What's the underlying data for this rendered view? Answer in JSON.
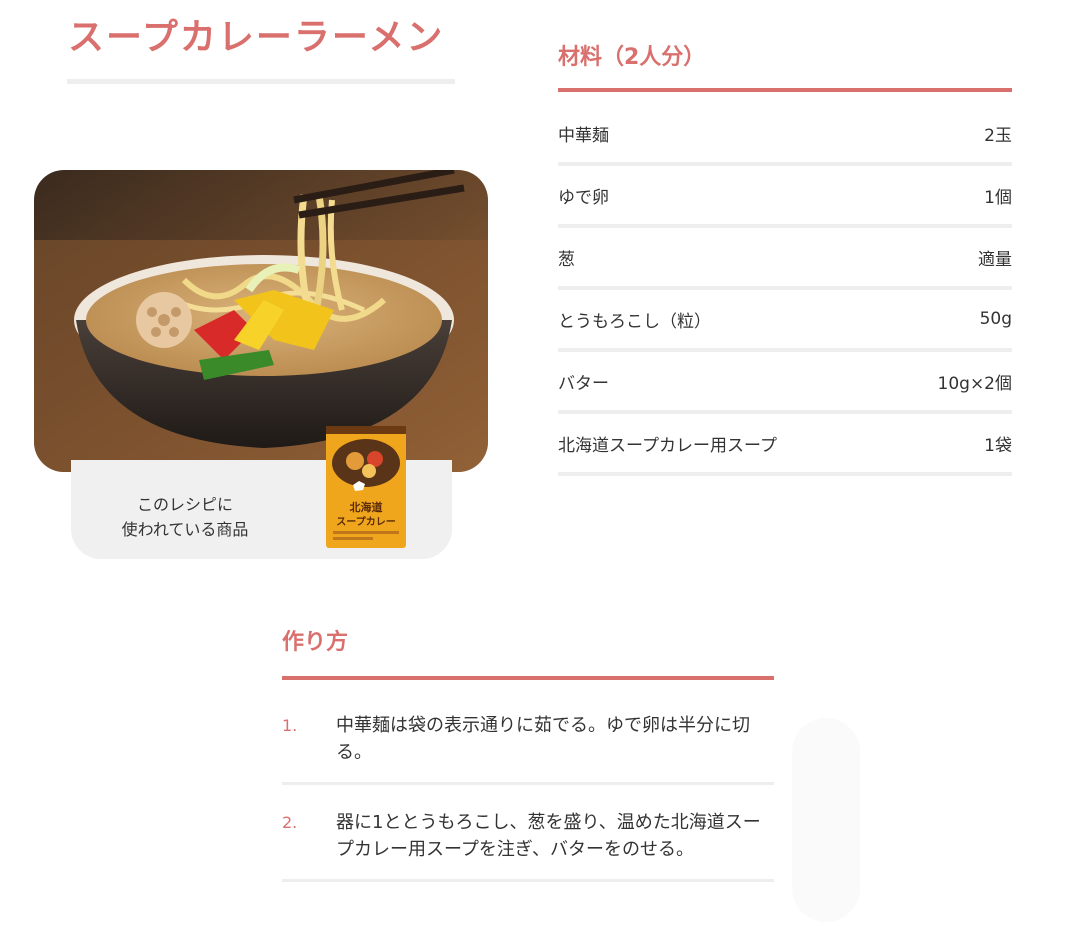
{
  "recipe": {
    "title": "スープカレーラーメン"
  },
  "product": {
    "caption_line1": "このレシピに",
    "caption_line2": "使われている商品",
    "package_title_line1": "北海道",
    "package_title_line2": "スープカレー"
  },
  "ingredients": {
    "heading": "材料（2人分）",
    "items": [
      {
        "name": "中華麺",
        "amount": "2玉"
      },
      {
        "name": "ゆで卵",
        "amount": "1個"
      },
      {
        "name": "葱",
        "amount": "適量"
      },
      {
        "name": "とうもろこし（粒）",
        "amount": "50g"
      },
      {
        "name": "バター",
        "amount": "10g×2個"
      },
      {
        "name": "北海道スープカレー用スープ",
        "amount": "1袋"
      }
    ]
  },
  "method": {
    "heading": "作り方",
    "steps": [
      {
        "number": "1.",
        "text": "中華麺は袋の表示通りに茹でる。ゆで卵は半分に切る。"
      },
      {
        "number": "2.",
        "text": "器に1ととうもろこし、葱を盛り、温めた北海道スープカレー用スープを注ぎ、バターをのせる。"
      }
    ]
  },
  "colors": {
    "accent": "#d9706e",
    "rule_light": "#eeeeee",
    "product_box": "#f0f0f0",
    "text": "#333333"
  }
}
